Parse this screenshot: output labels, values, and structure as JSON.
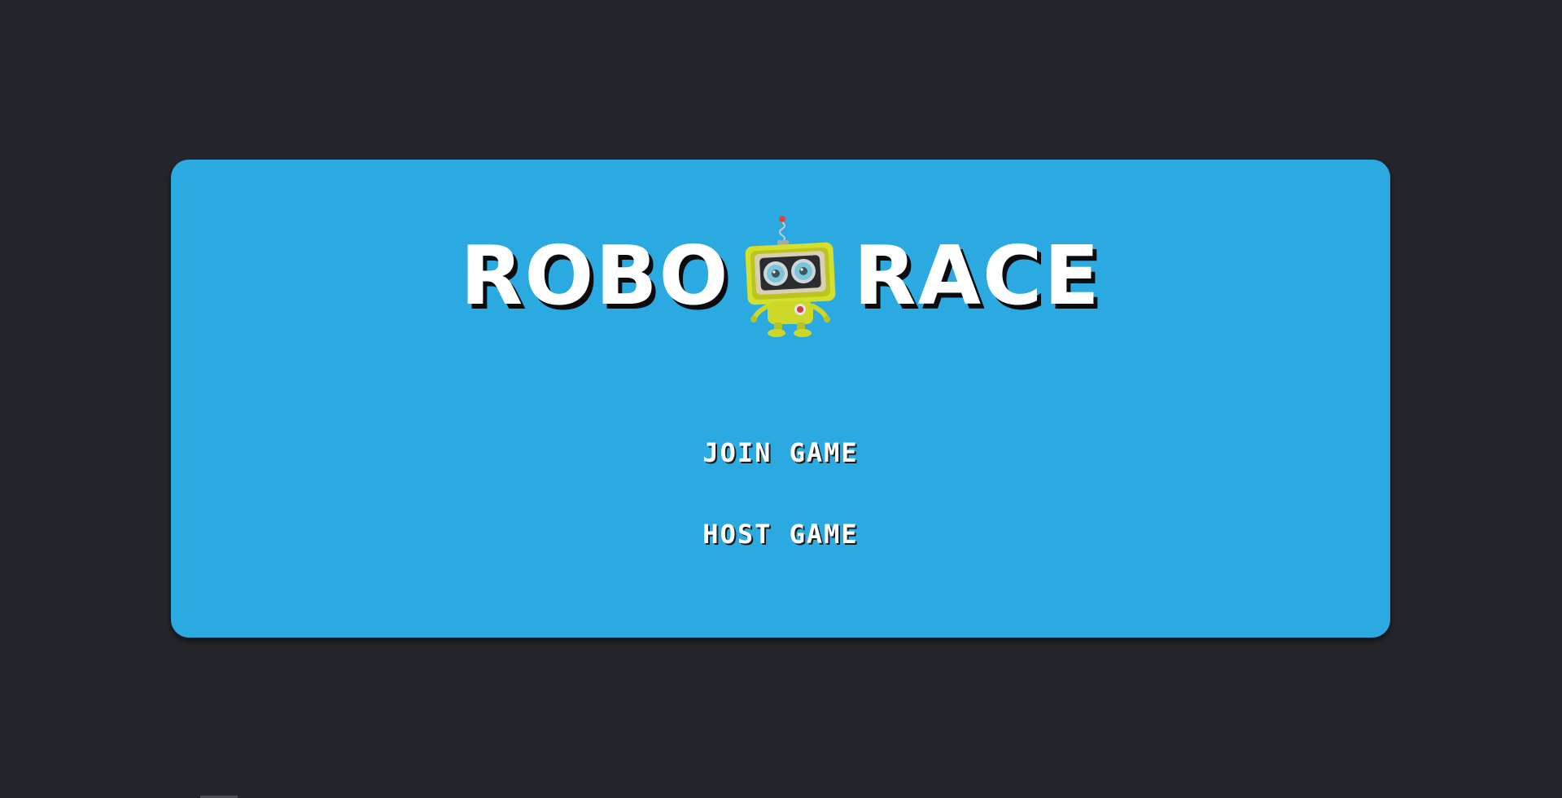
{
  "logo": {
    "word_left": "ROBO",
    "word_right": "RACE",
    "mascot_icon": "robot-mascot-icon"
  },
  "menu": {
    "join_label": "JOIN GAME",
    "host_label": "HOST GAME"
  },
  "colors": {
    "background": "#25262b",
    "panel": "#2ba9e1",
    "text": "#ffffff",
    "text_shadow": "#0b0b10",
    "robot_body": "#d4e02a"
  }
}
